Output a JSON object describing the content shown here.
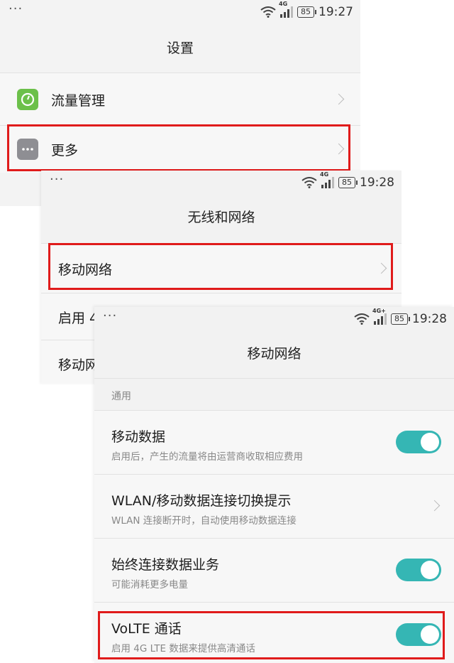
{
  "screen1": {
    "status": {
      "dots": "···",
      "network": "4G",
      "battery": "85",
      "time": "19:27"
    },
    "title": "设置",
    "items": [
      {
        "label": "流量管理",
        "icon": "data-usage-icon",
        "icon_color": "#6cc04a"
      },
      {
        "label": "更多",
        "icon": "more-dots-icon",
        "icon_color": "#8e8e93"
      }
    ]
  },
  "screen2": {
    "status": {
      "dots": "···",
      "network": "4G",
      "battery": "85",
      "time": "19:28"
    },
    "title": "无线和网络",
    "items": [
      {
        "label": "移动网络"
      },
      {
        "label": "启用 4"
      },
      {
        "label": "移动网"
      }
    ]
  },
  "screen3": {
    "status": {
      "dots": "···",
      "network": "4G+",
      "battery": "85",
      "time": "19:28"
    },
    "title": "移动网络",
    "section": "通用",
    "items": [
      {
        "label": "移动数据",
        "sub": "启用后，产生的流量将由运营商收取相应费用",
        "control": "toggle-on"
      },
      {
        "label": "WLAN/移动数据连接切换提示",
        "sub": "WLAN 连接断开时，自动使用移动数据连接",
        "control": "chevron"
      },
      {
        "label": "始终连接数据业务",
        "sub": "可能消耗更多电量",
        "control": "toggle-on"
      },
      {
        "label": "VoLTE 通话",
        "sub": "启用 4G LTE 数据来提供高清通话",
        "control": "toggle-on"
      }
    ]
  },
  "colors": {
    "highlight": "#e01b1b",
    "toggle_on": "#35b6b4"
  }
}
